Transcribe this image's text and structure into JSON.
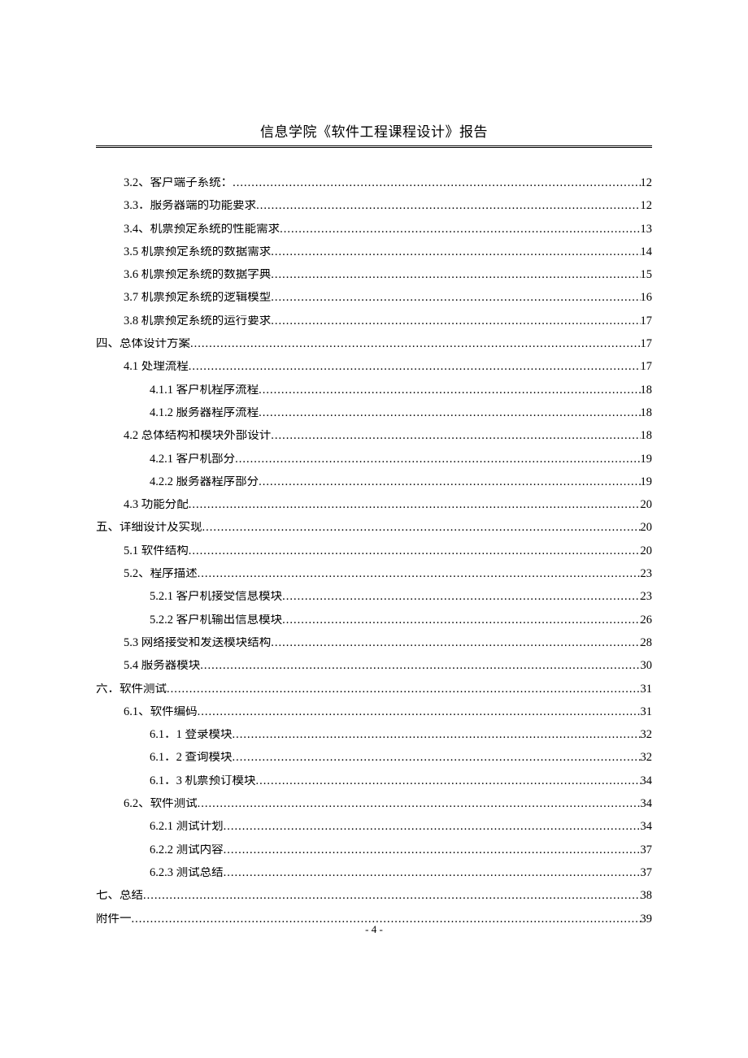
{
  "header": {
    "title": "信息学院《软件工程课程设计》报告"
  },
  "toc": [
    {
      "indent": 1,
      "label": "3.2、客户端子系统：",
      "page": "12"
    },
    {
      "indent": 1,
      "label": "3.3．服务器端的功能要求",
      "page": "12"
    },
    {
      "indent": 1,
      "label": "3.4、机票预定系统的性能需求",
      "page": "13"
    },
    {
      "indent": 1,
      "label": "3.5 机票预定系统的数据需求",
      "page": "14"
    },
    {
      "indent": 1,
      "label": "3.6 机票预定系统的数据字典",
      "page": "15"
    },
    {
      "indent": 1,
      "label": "3.7 机票预定系统的逻辑模型",
      "page": "16"
    },
    {
      "indent": 1,
      "label": "3.8 机票预定系统的运行要求",
      "page": "17"
    },
    {
      "indent": 0,
      "label": "四、总体设计方案",
      "page": "17"
    },
    {
      "indent": 1,
      "label": "4.1 处理流程",
      "page": "17"
    },
    {
      "indent": 2,
      "label": "4.1.1 客户机程序流程",
      "page": "18"
    },
    {
      "indent": 2,
      "label": "4.1.2 服务器程序流程",
      "page": "18"
    },
    {
      "indent": 1,
      "label": "4.2 总体结构和模块外部设计",
      "page": "18"
    },
    {
      "indent": 2,
      "label": "4.2.1 客户机部分",
      "page": "19"
    },
    {
      "indent": 2,
      "label": "4.2.2 服务器程序部分",
      "page": "19"
    },
    {
      "indent": 1,
      "label": "4.3 功能分配",
      "page": "20"
    },
    {
      "indent": 0,
      "label": "五、详细设计及实现",
      "page": "20"
    },
    {
      "indent": 1,
      "label": "5.1 软件结构",
      "page": "20"
    },
    {
      "indent": 1,
      "label": "5.2、程序描述",
      "page": "23"
    },
    {
      "indent": 2,
      "label": "5.2.1 客户机接受信息模块",
      "page": "23"
    },
    {
      "indent": 2,
      "label": "5.2.2 客户机输出信息模块",
      "page": "26"
    },
    {
      "indent": 1,
      "label": "5.3 网络接受和发送模块结构",
      "page": "28"
    },
    {
      "indent": 1,
      "label": "5.4 服务器模块",
      "page": "30"
    },
    {
      "indent": 0,
      "label": "六．软件测试",
      "page": "31"
    },
    {
      "indent": 1,
      "label": "6.1、软件编码",
      "page": "31"
    },
    {
      "indent": 2,
      "label": "6.1．1 登录模块",
      "page": "32"
    },
    {
      "indent": 2,
      "label": "6.1．2 查询模块",
      "page": "32"
    },
    {
      "indent": 2,
      "label": "6.1．3 机票预订模块",
      "page": "34"
    },
    {
      "indent": 1,
      "label": "6.2、软件测试",
      "page": "34"
    },
    {
      "indent": 2,
      "label": "6.2.1 测试计划",
      "page": "34"
    },
    {
      "indent": 2,
      "label": "6.2.2 测试内容",
      "page": "37"
    },
    {
      "indent": 2,
      "label": "6.2.3 测试总结",
      "page": "37"
    },
    {
      "indent": 0,
      "label": "七、总结",
      "page": "38"
    },
    {
      "indent": 0,
      "label": "附件一",
      "page": "39"
    }
  ],
  "footer": {
    "page_number": "- 4 -"
  }
}
